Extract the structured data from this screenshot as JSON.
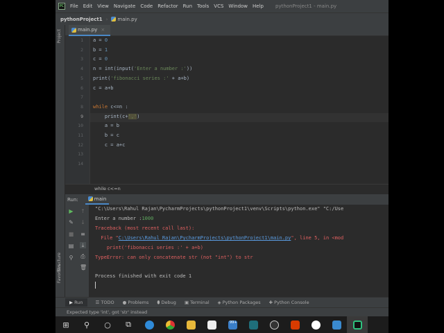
{
  "menu": {
    "logo": "PC",
    "items": [
      "File",
      "Edit",
      "View",
      "Navigate",
      "Code",
      "Refactor",
      "Run",
      "Tools",
      "VCS",
      "Window",
      "Help"
    ],
    "title": "pythonProject1 - main.py"
  },
  "breadcrumb": {
    "project": "pythonProject1",
    "file": "main.py"
  },
  "side_labels": {
    "project": "Project",
    "structure": "Structure",
    "favorites": "Favorites"
  },
  "editor": {
    "tab": "main.py",
    "current_line": 9,
    "lines": [
      [
        "a = ",
        "0",
        ""
      ],
      [
        "b = ",
        "1",
        ""
      ],
      [
        "c = ",
        "0",
        ""
      ],
      [
        "n = int(input(",
        "'Enter a number :'",
        "))"
      ],
      [
        "print(",
        "'fibonacci series :'",
        " + a+b)"
      ],
      [
        "c = a+b",
        "",
        ""
      ],
      [
        "",
        "",
        ""
      ],
      [
        "while",
        " c<=n :",
        ""
      ],
      [
        "    print(c+",
        "','",
        ")"
      ],
      [
        "    a = b",
        "",
        ""
      ],
      [
        "    b = c",
        "",
        ""
      ],
      [
        "    c = a+c",
        "",
        ""
      ],
      [
        "",
        "",
        ""
      ],
      [
        "",
        "",
        ""
      ]
    ],
    "hint": "while c<=n"
  },
  "run": {
    "label": "Run:",
    "tab": "main",
    "cmd": "\"C:\\Users\\Rahul Rajan\\PycharmProjects\\pythonProject1\\venv\\Scripts\\python.exe\" \"C:/Use",
    "prompt": "Enter a number :",
    "input": "1000",
    "traceback": "Traceback (most recent call last):",
    "file_prefix": "  File \"",
    "file_link": "C:\\Users\\Rahul Rajan\\PycharmProjects\\pythonProject1\\main.py",
    "file_suffix": "\", line 5, in <mod",
    "src": "    print('fibonacci series :' + a+b)",
    "error": "TypeError: can only concatenate str (not \"int\") to str",
    "exit": "Process finished with exit code 1"
  },
  "tool_tabs": [
    "Run",
    "TODO",
    "Problems",
    "Debug",
    "Terminal",
    "Python Packages",
    "Python Console"
  ],
  "status": "Expected type 'int', got 'str' instead",
  "taskbar": {
    "badge": "99+"
  }
}
